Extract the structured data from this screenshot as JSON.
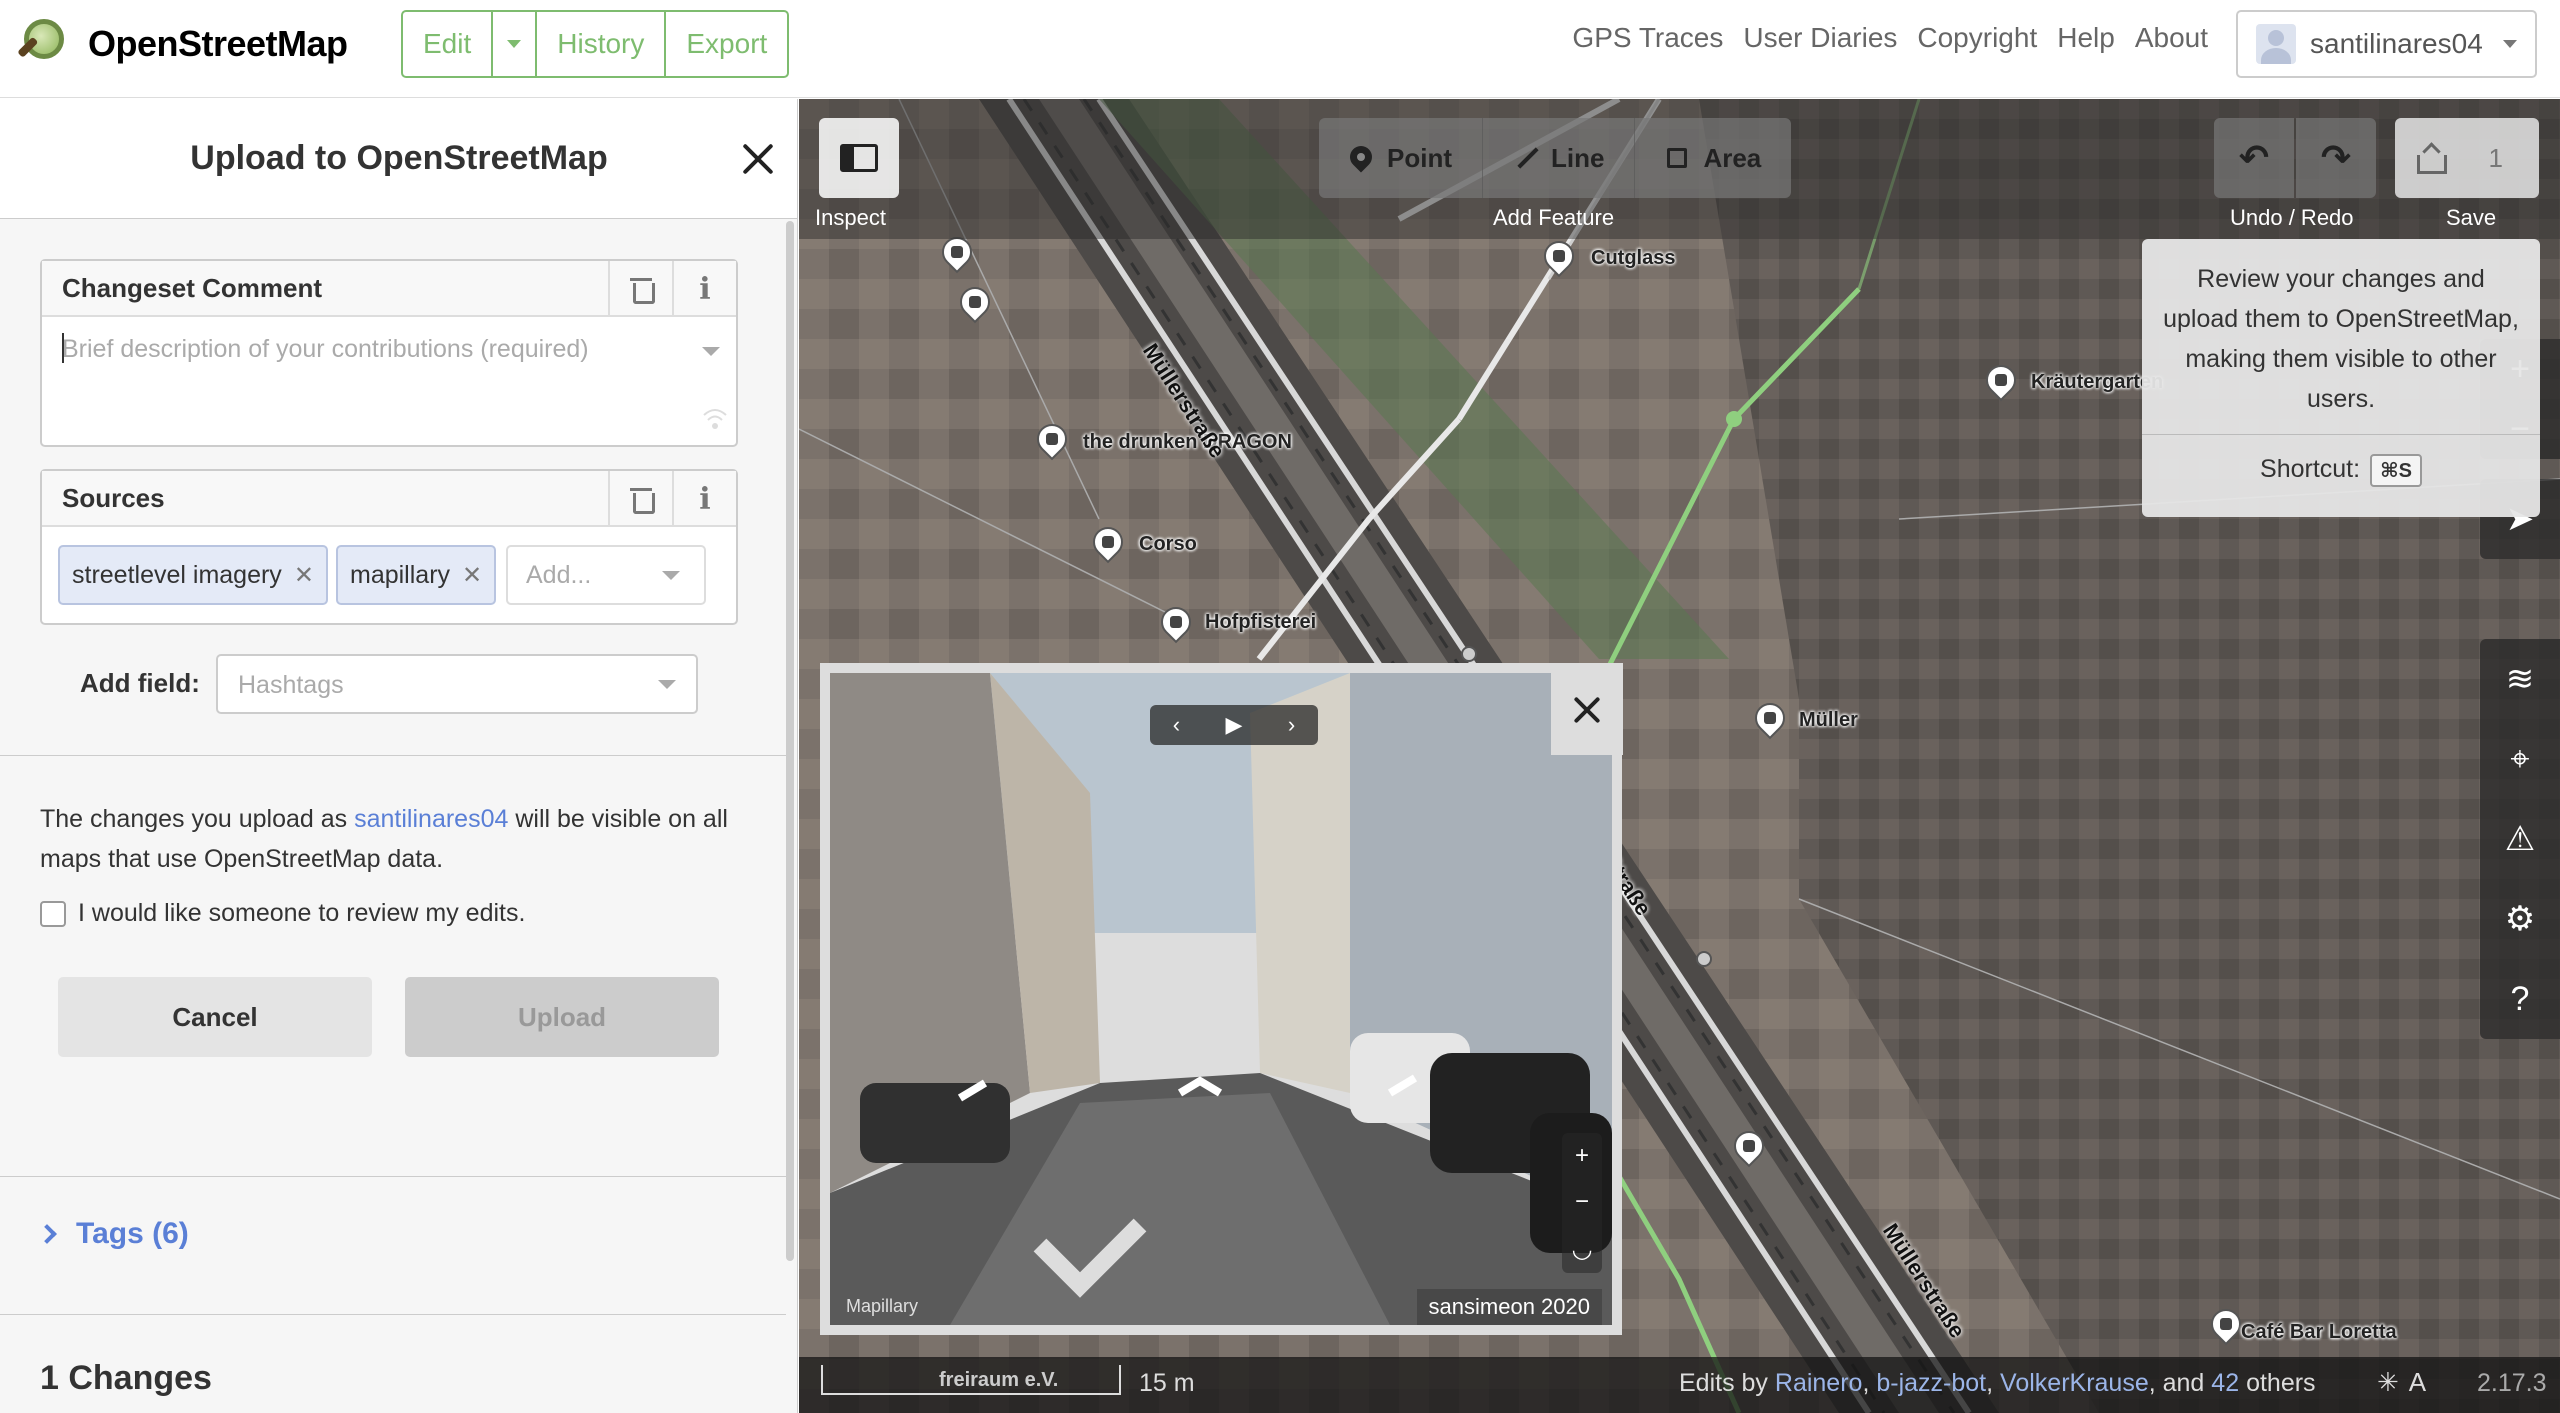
{
  "header": {
    "logo_text": "OpenStreetMap",
    "edit_label": "Edit",
    "history_label": "History",
    "export_label": "Export",
    "nav": [
      "GPS Traces",
      "User Diaries",
      "Copyright",
      "Help",
      "About"
    ],
    "username": "santilinares04"
  },
  "sidebar": {
    "title": "Upload to OpenStreetMap",
    "changeset": {
      "label": "Changeset Comment",
      "placeholder": "Brief description of your contributions (required)"
    },
    "sources": {
      "label": "Sources",
      "chips": [
        "streetlevel imagery",
        "mapillary"
      ],
      "add_placeholder": "Add..."
    },
    "add_field": {
      "label": "Add field:",
      "placeholder": "Hashtags"
    },
    "note": {
      "prefix": "The changes you upload as ",
      "user": "santilinares04",
      "suffix": " will be visible on all maps that use OpenStreetMap data."
    },
    "review_label": "I would like someone to review my edits.",
    "cancel_label": "Cancel",
    "upload_label": "Upload",
    "tags_label": "Tags (6)",
    "changes_title": "1 Changes"
  },
  "map": {
    "inspect_label": "Inspect",
    "feature": {
      "point": "Point",
      "line": "Line",
      "area": "Area",
      "label": "Add Feature"
    },
    "undo_label": "Undo / Redo",
    "save_label": "Save",
    "save_count": "1",
    "tooltip": {
      "text": "Review your changes and upload them to OpenStreetMap, making them visible to other users.",
      "shortcut_label": "Shortcut:",
      "shortcut_key": "⌘S"
    },
    "labels": {
      "cutglass": "Cutglass",
      "dragon": "the drunken DRAGON",
      "corso": "Corso",
      "hofpfisterei": "Hofpfisterei",
      "krautergarten": "Kräutergarten",
      "muller": "Müller",
      "cafe": "Café Bar Loretta",
      "freiraum": "freiraum e.V.",
      "street1": "Müllerstraße",
      "street2": "Müllerstraße",
      "street3": "Straße"
    },
    "viewer": {
      "credit": "sansimeon 2020",
      "brand": "Mapillary"
    },
    "footer": {
      "scale": "15 m",
      "edits_by": "Edits by",
      "editors": [
        "Rainero",
        "b-jazz-bot",
        "VolkerKrause"
      ],
      "and": ", and",
      "others_count": "42",
      "others": "others",
      "version": "2.17.3"
    }
  }
}
